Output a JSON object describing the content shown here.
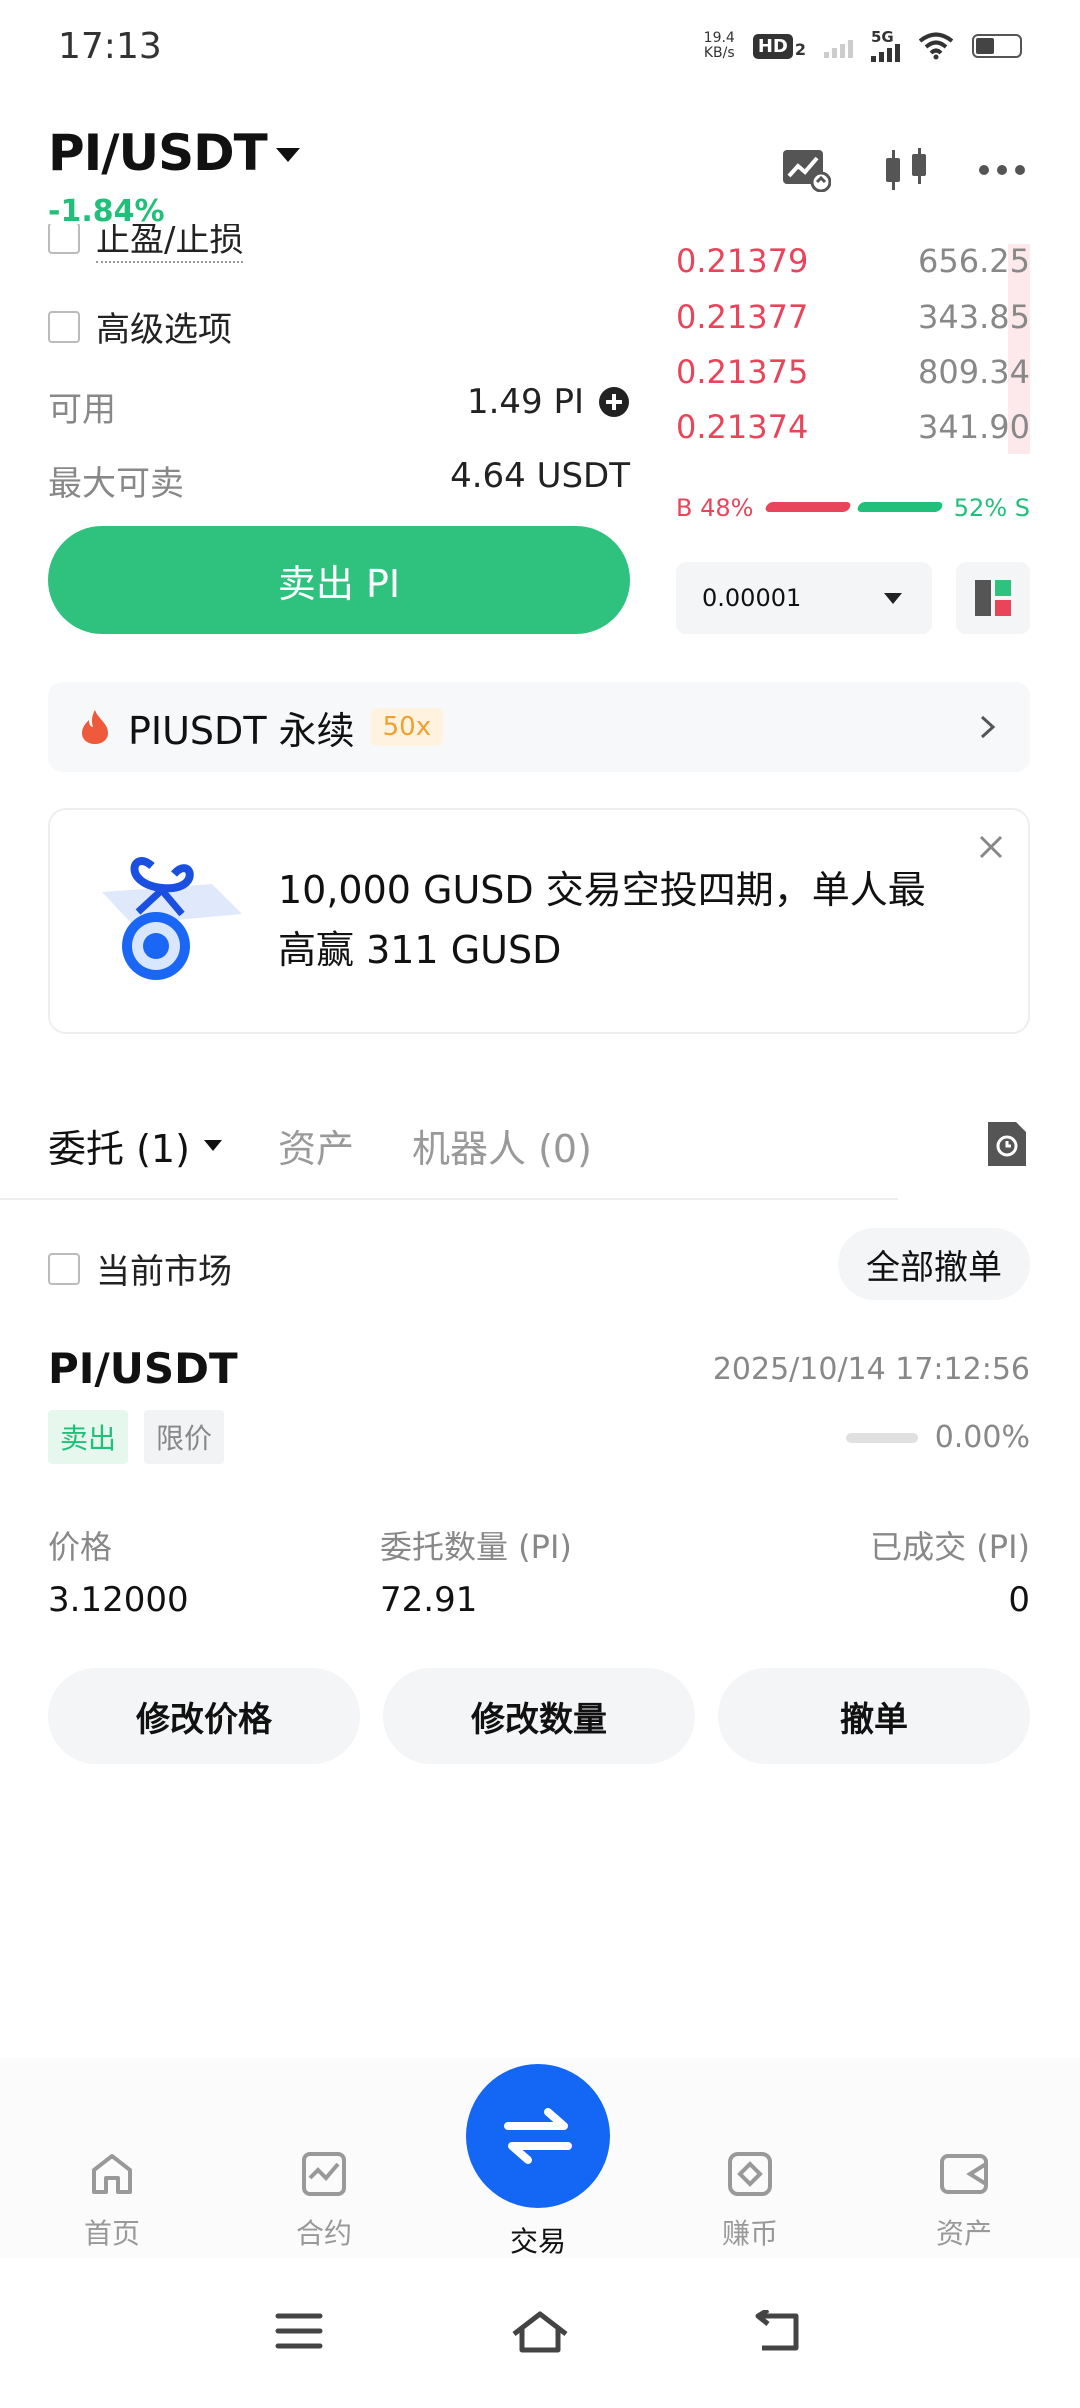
{
  "status_bar": {
    "time": "17:13",
    "net_speed": "19.4",
    "net_unit": "KB/s",
    "hd_label": "HD",
    "hd_sub": "2",
    "network": "5G"
  },
  "header": {
    "pair": "PI/USDT",
    "change": "-1.84%"
  },
  "form": {
    "tp_sl_label": "止盈/止损",
    "advanced_label": "高级选项",
    "available_label": "可用",
    "available_value": "1.49 PI",
    "max_sell_label": "最大可卖",
    "max_sell_value": "4.64 USDT",
    "sell_button": "卖出 PI"
  },
  "orderbook": {
    "asks": [
      {
        "price": "0.21379",
        "qty": "656.25"
      },
      {
        "price": "0.21377",
        "qty": "343.85"
      },
      {
        "price": "0.21375",
        "qty": "809.34"
      },
      {
        "price": "0.21374",
        "qty": "341.90"
      }
    ],
    "buy_ratio": "B 48%",
    "sell_ratio": "52% S",
    "precision": "0.00001"
  },
  "perp_banner": {
    "name": "PIUSDT 永续",
    "leverage": "50x"
  },
  "promo": {
    "text": "10,000 GUSD 交易空投四期，单人最高赢 311 GUSD"
  },
  "tabs": {
    "orders": "委托 (1)",
    "assets": "资产",
    "bots": "机器人 (0)"
  },
  "filter": {
    "current_market": "当前市场",
    "cancel_all": "全部撤单"
  },
  "order": {
    "pair": "PI/USDT",
    "time": "2025/10/14 17:12:56",
    "side": "卖出",
    "type": "限价",
    "filled_pct": "0.00%",
    "price_label": "价格",
    "price_value": "3.12000",
    "qty_label": "委托数量 (PI)",
    "qty_value": "72.91",
    "filled_label": "已成交 (PI)",
    "filled_value": "0",
    "modify_price": "修改价格",
    "modify_qty": "修改数量",
    "cancel": "撤单"
  },
  "bottom_nav": {
    "home": "首页",
    "contract": "合约",
    "trade": "交易",
    "earn": "赚币",
    "assets": "资产"
  },
  "colors": {
    "green": "#2ec27e",
    "red": "#e8455a",
    "blue": "#1466f5"
  }
}
